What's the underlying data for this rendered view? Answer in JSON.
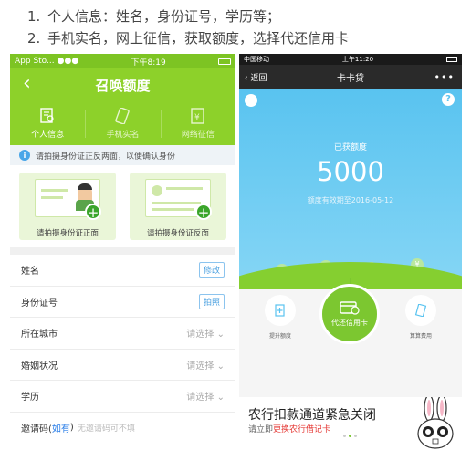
{
  "instructions": [
    {
      "num": "1.",
      "text": "个人信息：姓名，身份证号，学历等；"
    },
    {
      "num": "2.",
      "text": "手机实名，网上征信，获取额度，选择代还信用卡"
    }
  ],
  "left": {
    "status": {
      "carrier": "App Sto...",
      "time": "下午8:19"
    },
    "title": "召唤额度",
    "tabs": [
      {
        "label": "个人信息"
      },
      {
        "label": "手机实名"
      },
      {
        "label": "网络征信"
      }
    ],
    "notice": "请拍摄身份证正反两面，以便确认身份",
    "info_glyph": "i",
    "cards": [
      {
        "label": "请拍摄身份证正面"
      },
      {
        "label": "请拍摄身份证反面"
      }
    ],
    "plus_glyph": "+",
    "fields": [
      {
        "label": "姓名",
        "action": "修改"
      },
      {
        "label": "身份证号",
        "action": "拍照"
      },
      {
        "label": "所在城市",
        "value": "请选择"
      },
      {
        "label": "婚姻状况",
        "value": "请选择"
      },
      {
        "label": "学历",
        "value": "请选择"
      }
    ],
    "invite": {
      "label": "邀请码(",
      "link": "如有",
      "close": ")",
      "placeholder": "无邀请码可不填"
    },
    "accent": "#8dd12a"
  },
  "right": {
    "status": {
      "carrier": "中国移动",
      "time": "上午11:20"
    },
    "back_label": "返回",
    "title": "卡卡贷",
    "more": "•••",
    "help": "?",
    "quota_label": "已获额度",
    "quota": "5000",
    "expiry": "额度有效期至2016-05-12",
    "coin_glyph": "¥",
    "main_action": "代还信用卡",
    "left_action": "提升额度",
    "right_action": "算算费用",
    "banner_title": "农行扣款通道紧急关闭",
    "banner_sub_prefix": "请立即",
    "banner_sub_link": "更换农行借记卡",
    "accent": "#59c3f0"
  }
}
